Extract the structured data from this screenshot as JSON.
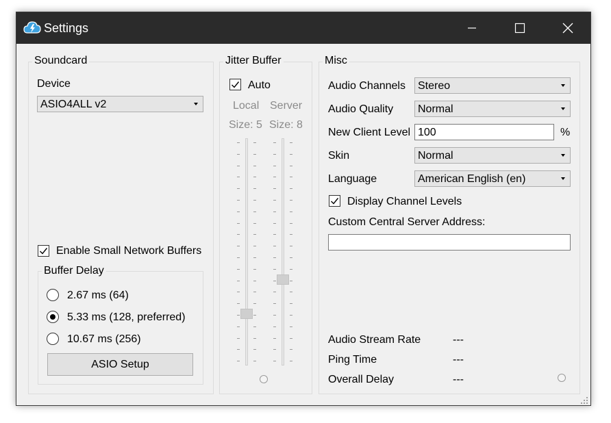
{
  "window": {
    "title": "Settings",
    "controls": [
      "minimize-icon",
      "maximize-icon",
      "close-icon"
    ]
  },
  "soundcard": {
    "group_title": "Soundcard",
    "device_label": "Device",
    "device_value": "ASIO4ALL v2",
    "small_buffers_label": "Enable Small Network Buffers",
    "small_buffers_checked": true,
    "buffer_delay": {
      "group_title": "Buffer Delay",
      "options": [
        {
          "label": "2.67 ms (64)",
          "selected": false
        },
        {
          "label": "5.33 ms (128, preferred)",
          "selected": true
        },
        {
          "label": "10.67 ms (256)",
          "selected": false
        }
      ]
    },
    "asio_button": "ASIO Setup"
  },
  "jitter": {
    "group_title": "Jitter Buffer",
    "auto_label": "Auto",
    "auto_checked": true,
    "local_label": "Local",
    "server_label": "Server",
    "local_size": "Size: 5",
    "server_size": "Size: 8"
  },
  "misc": {
    "group_title": "Misc",
    "audio_channels_label": "Audio Channels",
    "audio_channels_value": "Stereo",
    "audio_quality_label": "Audio Quality",
    "audio_quality_value": "Normal",
    "new_client_level_label": "New Client Level",
    "new_client_level_value": "100",
    "percent": "%",
    "skin_label": "Skin",
    "skin_value": "Normal",
    "language_label": "Language",
    "language_value": "American English (en)",
    "display_levels_label": "Display Channel Levels",
    "display_levels_checked": true,
    "custom_server_label": "Custom Central Server Address:",
    "custom_server_value": "",
    "stats": {
      "stream_rate_label": "Audio Stream Rate",
      "stream_rate_value": "---",
      "ping_label": "Ping Time",
      "ping_value": "---",
      "overall_delay_label": "Overall Delay",
      "overall_delay_value": "---"
    }
  },
  "colors": {
    "titlebar": "#2b2b2b",
    "window_bg": "#f0f0f0",
    "app_icon": "#3ea2df"
  }
}
